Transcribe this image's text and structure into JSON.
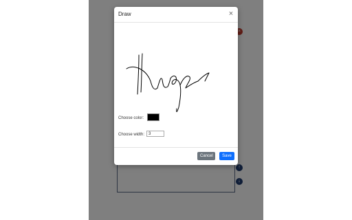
{
  "modal": {
    "title": "Draw",
    "close_glyph": "×",
    "color_label": "Choose color:",
    "color_value": "#000000",
    "width_label": "Choose width:",
    "width_value": "3",
    "cancel_label": "Cancel",
    "save_label": "Save"
  },
  "colors": {
    "overlay": "#808080",
    "cancel_button": "#6c757d",
    "save_button": "#0d6efd"
  }
}
